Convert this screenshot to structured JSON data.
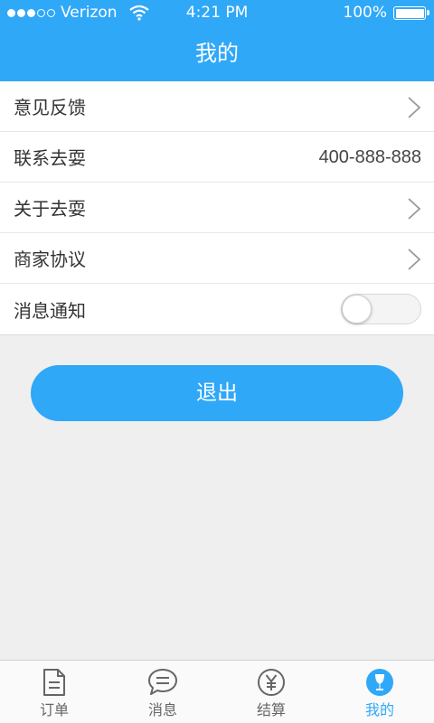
{
  "status_bar": {
    "carrier": "Verizon",
    "time": "4:21 PM",
    "battery": "100%"
  },
  "header": {
    "title": "我的"
  },
  "menu": {
    "feedback": "意见反馈",
    "contact": "联系去耍",
    "contact_phone": "400-888-888",
    "about": "关于去耍",
    "agreement": "商家协议",
    "notifications": "消息通知",
    "notifications_on": false
  },
  "logout_label": "退出",
  "tabs": [
    {
      "label": "订单",
      "icon": "document-icon"
    },
    {
      "label": "消息",
      "icon": "chat-bubble-icon"
    },
    {
      "label": "结算",
      "icon": "yen-icon"
    },
    {
      "label": "我的",
      "icon": "profile-icon",
      "active": true
    }
  ],
  "colors": {
    "primary": "#2fa8f8",
    "background": "#efefef"
  }
}
